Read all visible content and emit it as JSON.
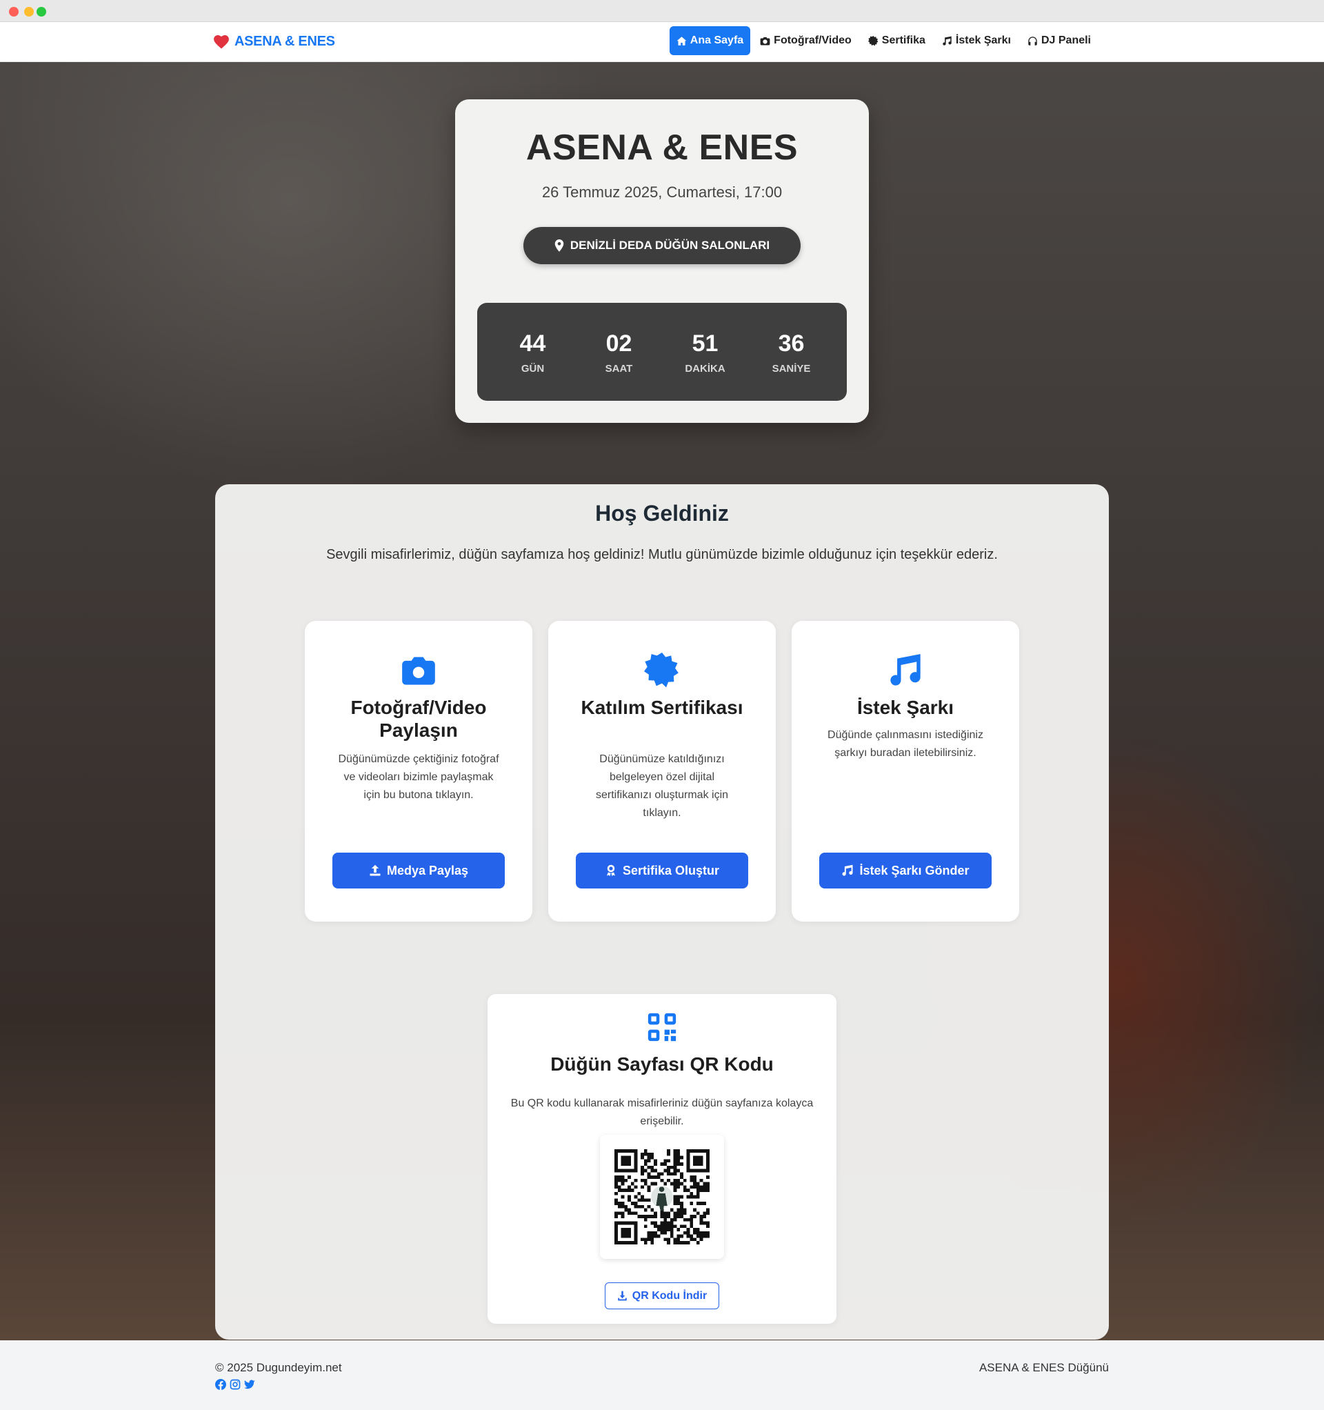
{
  "nav": {
    "brand": "ASENA & ENES",
    "links": [
      {
        "label": "Ana Sayfa",
        "icon": "home-icon",
        "active": true
      },
      {
        "label": "Fotoğraf/Video",
        "icon": "camera-icon"
      },
      {
        "label": "Sertifika",
        "icon": "badge-icon"
      },
      {
        "label": "İstek Şarkı",
        "icon": "music-icon"
      },
      {
        "label": "DJ Paneli",
        "icon": "headphones-icon"
      }
    ]
  },
  "hero": {
    "title": "ASENA & ENES",
    "date": "26 Temmuz 2025, Cumartesi, 17:00",
    "venue": "DENİZLİ DEDA DÜĞÜN SALONLARI",
    "countdown": [
      {
        "value": "44",
        "label": "GÜN"
      },
      {
        "value": "02",
        "label": "SAAT"
      },
      {
        "value": "51",
        "label": "DAKİKA"
      },
      {
        "value": "36",
        "label": "SANİYE"
      }
    ]
  },
  "welcome": {
    "title": "Hoş Geldiniz",
    "text": "Sevgili misafirlerimiz, düğün sayfamıza hoş geldiniz! Mutlu günümüzde bizimle olduğunuz için teşekkür ederiz."
  },
  "features": [
    {
      "icon": "camera-icon",
      "title": "Fotoğraf/Video Paylaşın",
      "desc": "Düğünümüzde çektiğiniz fotoğraf ve videoları bizimle paylaşmak için bu butona tıklayın.",
      "button": "Medya Paylaş",
      "button_icon": "upload-icon"
    },
    {
      "icon": "certificate-icon",
      "title": "Katılım Sertifikası",
      "desc": "Düğünümüze katıldığınızı belgeleyen özel dijital sertifikanızı oluşturmak için tıklayın.",
      "button": "Sertifika Oluştur",
      "button_icon": "award-icon"
    },
    {
      "icon": "music-icon",
      "title": "İstek Şarkı",
      "desc": "Düğünde çalınmasını istediğiniz şarkıyı buradan iletebilirsiniz.",
      "button": "İstek Şarkı Gönder",
      "button_icon": "music-icon"
    }
  ],
  "qr": {
    "title": "Düğün Sayfası QR Kodu",
    "desc": "Bu QR kodu kullanarak misafirleriniz düğün sayfanıza kolayca erişebilir.",
    "download": "QR Kodu İndir"
  },
  "footer": {
    "copyright": "© 2025 Dugundeyim.net",
    "right": "ASENA & ENES Düğünü",
    "socials": [
      "facebook-icon",
      "instagram-icon",
      "twitter-icon"
    ]
  },
  "colors": {
    "accent": "#1877f2",
    "button": "#2563eb",
    "heart": "#e0323f",
    "dark": "#3f3f3f"
  }
}
